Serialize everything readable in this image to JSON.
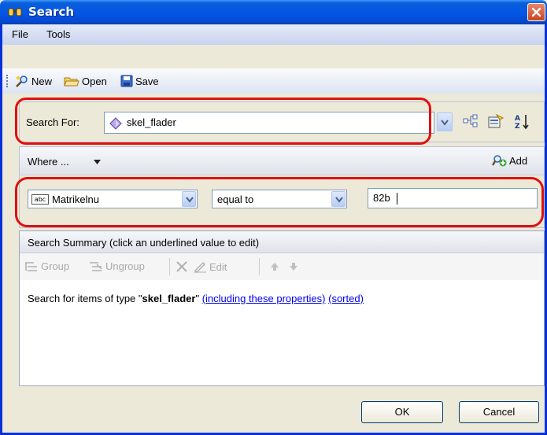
{
  "window": {
    "title": "Search"
  },
  "menu": [
    "File",
    "Tools"
  ],
  "toolbar": {
    "new": "New",
    "open": "Open",
    "save": "Save"
  },
  "search_for": {
    "label": "Search For:",
    "value": "skel_flader"
  },
  "where": {
    "label": "Where ...",
    "add": "Add"
  },
  "criteria": {
    "field": "Matrikelnu",
    "field_type_badge": "abc",
    "operator": "equal to",
    "value": "82b"
  },
  "summary": {
    "header": "Search Summary (click an underlined value to edit)",
    "tools": {
      "group": "Group",
      "ungroup": "Ungroup",
      "edit": "Edit"
    },
    "text_prefix": "Search for items of type \"",
    "type_name": "skel_flader",
    "text_suffix": "\" ",
    "link_properties": "(including these properties)",
    "link_sorted": "(sorted)"
  },
  "buttons": {
    "ok": "OK",
    "cancel": "Cancel"
  },
  "colors": {
    "highlight": "#e01010",
    "link": "#0000ee",
    "titlebar": "#0456e6"
  }
}
